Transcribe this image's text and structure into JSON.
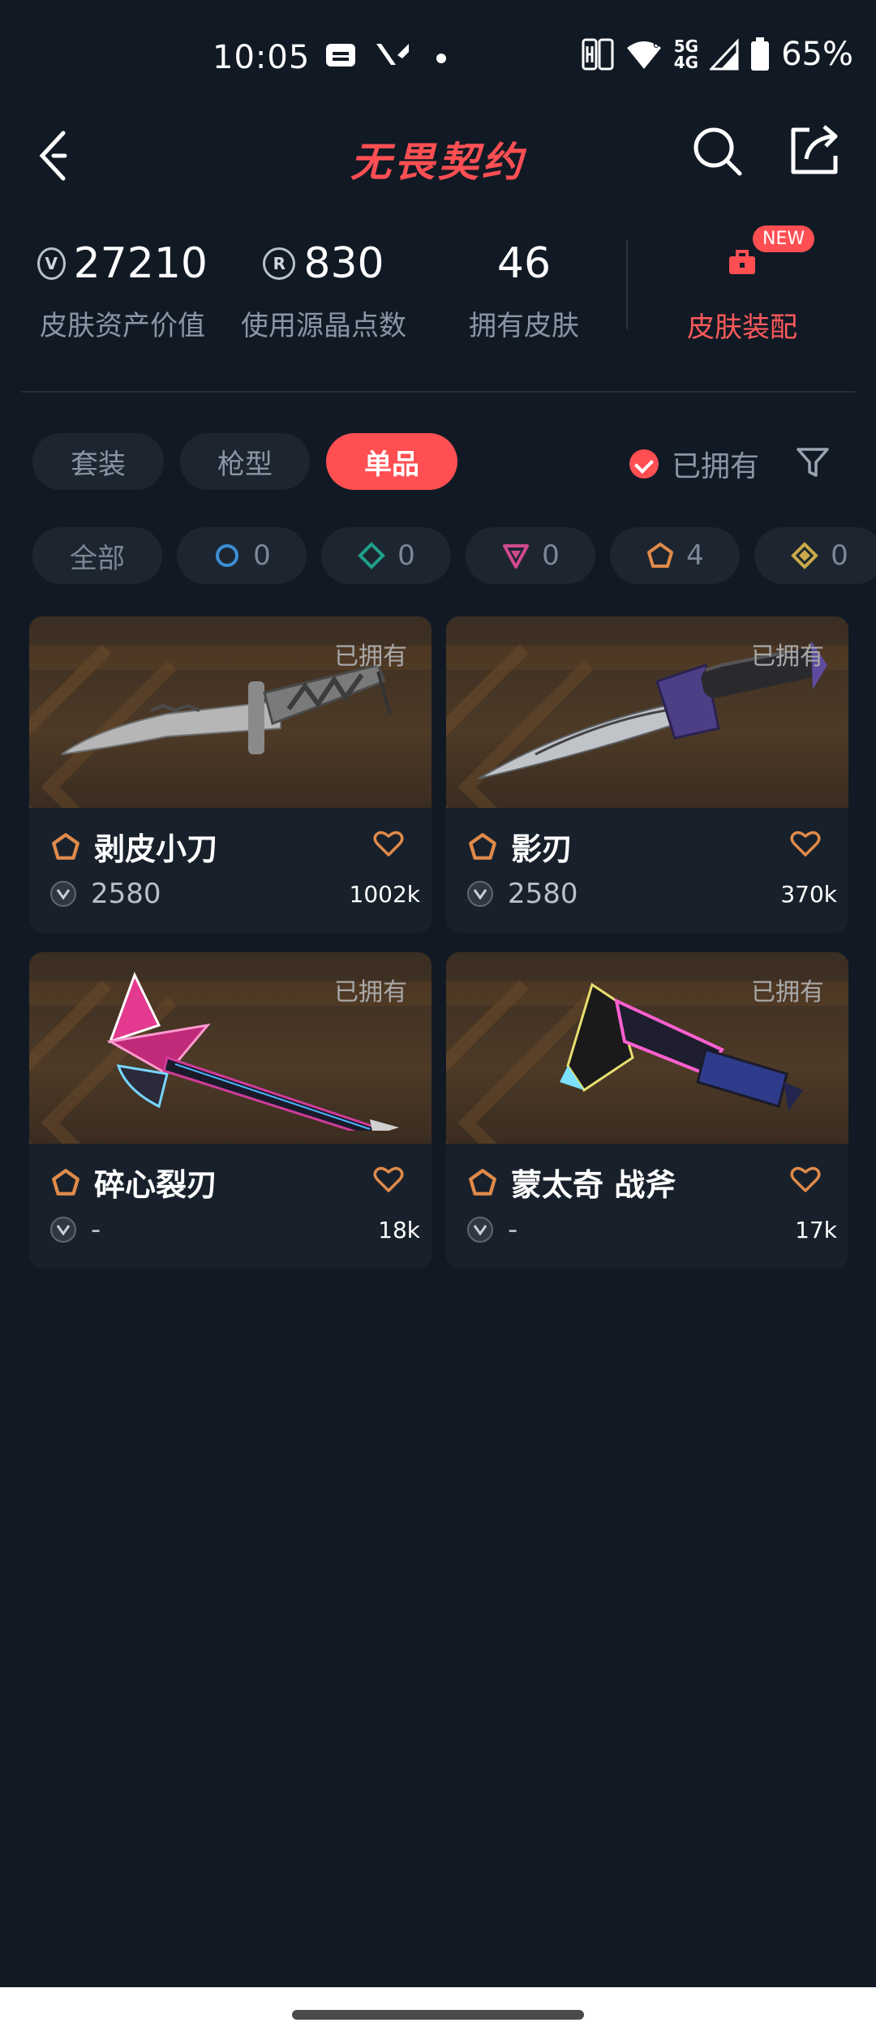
{
  "status_bar": {
    "time": "10:05",
    "network_5g": "5G",
    "network_4g": "4G",
    "battery": "65%"
  },
  "header": {
    "title": "无畏契约",
    "back_icon": "chevron-left-icon",
    "search_icon": "search-icon",
    "share_icon": "share-icon"
  },
  "stats": {
    "skin_value": {
      "value": "27210",
      "label": "皮肤资产价值"
    },
    "radianite": {
      "value": "830",
      "label": "使用源晶点数"
    },
    "owned_skins": {
      "value": "46",
      "label": "拥有皮肤"
    },
    "equip": {
      "label": "皮肤装配",
      "badge": "NEW"
    }
  },
  "tabs": [
    {
      "label": "套装",
      "active": false
    },
    {
      "label": "枪型",
      "active": false
    },
    {
      "label": "单品",
      "active": true
    }
  ],
  "owned_filter": {
    "label": "已拥有",
    "checked": true
  },
  "rarity_chips": [
    {
      "label": "全部"
    },
    {
      "count": "0",
      "color": "#3d8fd6"
    },
    {
      "count": "0",
      "color": "#1fa08a"
    },
    {
      "count": "0",
      "color": "#d04a8e"
    },
    {
      "count": "4",
      "color": "#e08a4a"
    },
    {
      "count": "0",
      "color": "#c9a94a"
    }
  ],
  "items": [
    {
      "name": "剥皮小刀",
      "price": "2580",
      "likes": "1002k",
      "owned_label": "已拥有"
    },
    {
      "name": "影刃",
      "price": "2580",
      "likes": "370k",
      "owned_label": "已拥有"
    },
    {
      "name": "碎心裂刃",
      "price": "-",
      "likes": "18k",
      "owned_label": "已拥有"
    },
    {
      "name": "蒙太奇 战斧",
      "price": "-",
      "likes": "17k",
      "owned_label": "已拥有"
    }
  ],
  "colors": {
    "accent": "#ff4f53",
    "background": "#111a24",
    "card": "#18212b",
    "exclusive": "#e08a4a"
  }
}
